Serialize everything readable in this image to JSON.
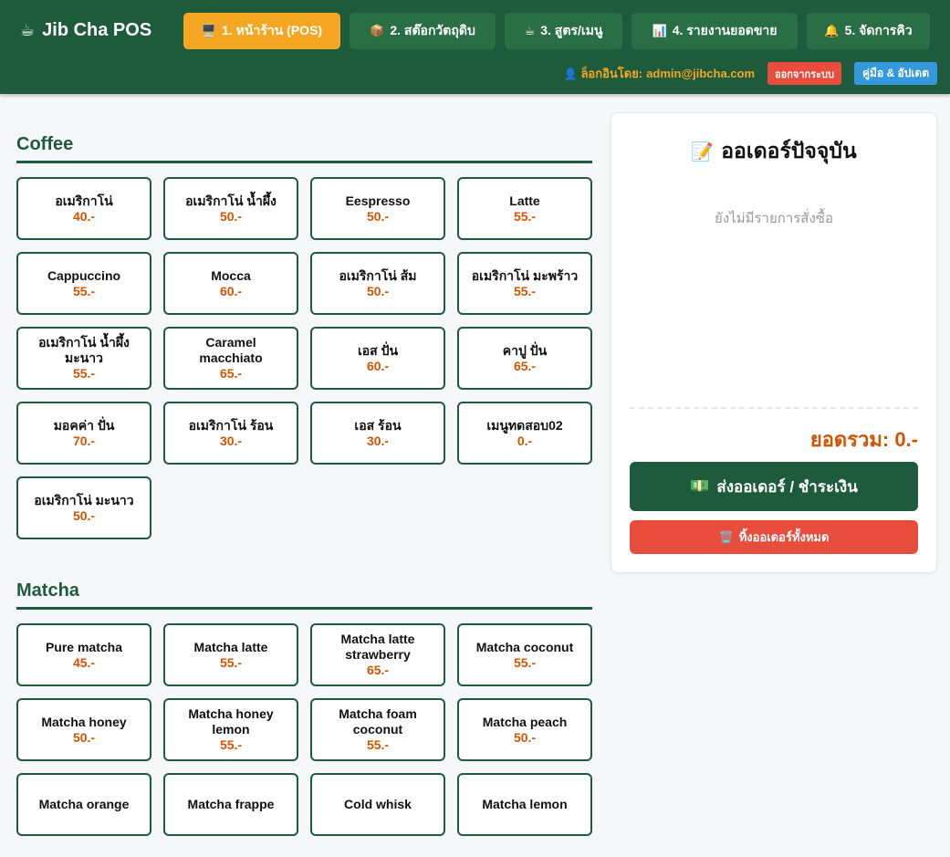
{
  "header": {
    "brand_icon": "coffee-cup-icon",
    "brand": "Jib Cha POS",
    "nav": [
      {
        "icon": "🖥️",
        "label": "1. หน้าร้าน (POS)",
        "active": true
      },
      {
        "icon": "📦",
        "label": "2. สต๊อกวัตถุดิบ"
      },
      {
        "icon": "☕",
        "label": "3. สูตร/เมนู"
      },
      {
        "icon": "📊",
        "label": "4. รายงานยอดขาย"
      },
      {
        "icon": "🔔",
        "label": "5. จัดการคิว"
      }
    ],
    "login_prefix": "ล็อกอินโดย:",
    "login_email": "admin@jibcha.com",
    "logout": "ออกจากระบบ",
    "manual": "คู่มือ & อัปเดต"
  },
  "categories": [
    {
      "title": "Coffee",
      "items": [
        {
          "name": "อเมริกาโน่",
          "price": "40.-"
        },
        {
          "name": "อเมริกาโน่ น้ำผึ้ง",
          "price": "50.-"
        },
        {
          "name": "Eespresso",
          "price": "50.-"
        },
        {
          "name": "Latte",
          "price": "55.-"
        },
        {
          "name": "Cappuccino",
          "price": "55.-"
        },
        {
          "name": "Mocca",
          "price": "60.-"
        },
        {
          "name": "อเมริกาโน่ ส้ม",
          "price": "50.-"
        },
        {
          "name": "อเมริกาโน่ มะพร้าว",
          "price": "55.-"
        },
        {
          "name": "อเมริกาโน่ น้ำผึ้ง มะนาว",
          "price": "55.-"
        },
        {
          "name": "Caramel macchiato",
          "price": "65.-"
        },
        {
          "name": "เอส ปั่น",
          "price": "60.-"
        },
        {
          "name": "คาปู ปั่น",
          "price": "65.-"
        },
        {
          "name": "มอคค่า ปั่น",
          "price": "70.-"
        },
        {
          "name": "อเมริกาโน่ ร้อน",
          "price": "30.-"
        },
        {
          "name": "เอส ร้อน",
          "price": "30.-"
        },
        {
          "name": "เมนูทดสอบ02",
          "price": "0.-"
        },
        {
          "name": "อเมริกาโน่ มะนาว",
          "price": "50.-"
        }
      ]
    },
    {
      "title": "Matcha",
      "items": [
        {
          "name": "Pure matcha",
          "price": "45.-"
        },
        {
          "name": "Matcha latte",
          "price": "55.-"
        },
        {
          "name": "Matcha latte strawberry",
          "price": "65.-"
        },
        {
          "name": "Matcha coconut",
          "price": "55.-"
        },
        {
          "name": "Matcha honey",
          "price": "50.-"
        },
        {
          "name": "Matcha honey lemon",
          "price": "55.-"
        },
        {
          "name": "Matcha foam coconut",
          "price": "55.-"
        },
        {
          "name": "Matcha peach",
          "price": "50.-"
        },
        {
          "name": "Matcha orange",
          "price": ""
        },
        {
          "name": "Matcha frappe",
          "price": ""
        },
        {
          "name": "Cold whisk",
          "price": ""
        },
        {
          "name": "Matcha lemon",
          "price": ""
        }
      ]
    }
  ],
  "order": {
    "icon": "📝",
    "title": "ออเดอร์ปัจจุบัน",
    "empty": "ยังไม่มีรายการสั่งซื้อ",
    "total": "ยอดรวม: 0.-",
    "checkout_icon": "💵",
    "checkout": "ส่งออเดอร์ / ชำระเงิน",
    "clear_icon": "🗑️",
    "clear": "ทิ้งออเดอร์ทั้งหมด"
  },
  "colors": {
    "primary": "#1e5b3c",
    "accent": "#f5a623",
    "price": "#d35400",
    "danger": "#e74c3c",
    "info": "#3498db"
  }
}
